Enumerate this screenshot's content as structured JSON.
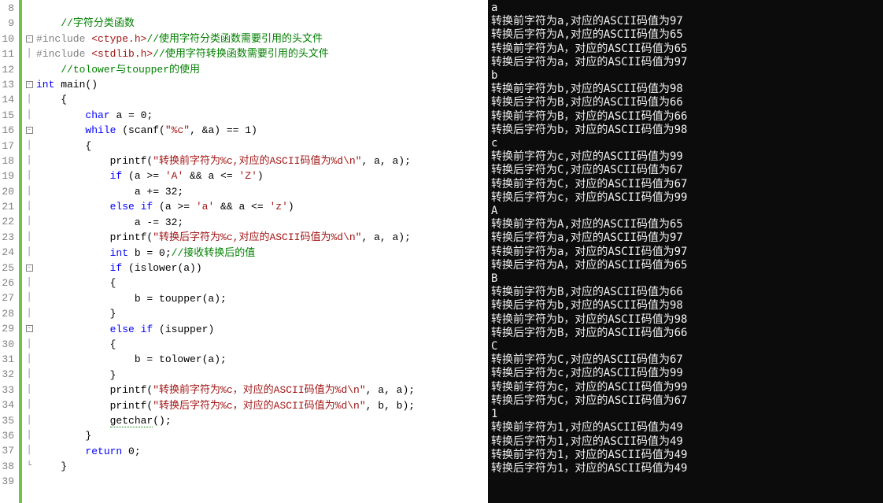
{
  "editor": {
    "first_line": 8,
    "lines": [
      {
        "n": 8,
        "fold": "",
        "tokens": []
      },
      {
        "n": 9,
        "fold": "",
        "tokens": [
          [
            "    ",
            ""
          ],
          [
            "//字符分类函数",
            "cmt"
          ]
        ]
      },
      {
        "n": 10,
        "fold": "box",
        "tokens": [
          [
            "#include ",
            "pp"
          ],
          [
            "<ctype.h>",
            "inc"
          ],
          [
            "//使用字符分类函数需要引用的头文件",
            "cmt"
          ]
        ]
      },
      {
        "n": 11,
        "fold": "bar",
        "tokens": [
          [
            "#include ",
            "pp"
          ],
          [
            "<stdlib.h>",
            "inc"
          ],
          [
            "//使用字符转换函数需要引用的头文件",
            "cmt"
          ]
        ]
      },
      {
        "n": 12,
        "fold": "",
        "tokens": [
          [
            "    ",
            ""
          ],
          [
            "//tolower与toupper的使用",
            "cmt"
          ]
        ]
      },
      {
        "n": 13,
        "fold": "box",
        "tokens": [
          [
            "int",
            "typ"
          ],
          [
            " main()",
            ""
          ]
        ]
      },
      {
        "n": 14,
        "fold": "bar",
        "tokens": [
          [
            "    {",
            ""
          ]
        ]
      },
      {
        "n": 15,
        "fold": "bar",
        "tokens": [
          [
            "        ",
            ""
          ],
          [
            "char",
            "typ"
          ],
          [
            " a = 0;",
            ""
          ]
        ]
      },
      {
        "n": 16,
        "fold": "box",
        "tokens": [
          [
            "        ",
            ""
          ],
          [
            "while",
            "kw"
          ],
          [
            " (scanf(",
            ""
          ],
          [
            "\"%c\"",
            "str"
          ],
          [
            ", &a) == 1)",
            ""
          ]
        ]
      },
      {
        "n": 17,
        "fold": "bar",
        "tokens": [
          [
            "        {",
            ""
          ]
        ]
      },
      {
        "n": 18,
        "fold": "bar",
        "tokens": [
          [
            "            printf(",
            ""
          ],
          [
            "\"转换前字符为%c,对应的ASCII码值为%d",
            "str"
          ],
          [
            "\\n",
            "esc"
          ],
          [
            "\"",
            "str"
          ],
          [
            ", a, a);",
            ""
          ]
        ]
      },
      {
        "n": 19,
        "fold": "bar",
        "tokens": [
          [
            "            ",
            ""
          ],
          [
            "if",
            "kw"
          ],
          [
            " (a >= ",
            ""
          ],
          [
            "'A'",
            "str"
          ],
          [
            " && a <= ",
            ""
          ],
          [
            "'Z'",
            "str"
          ],
          [
            ")",
            ""
          ]
        ]
      },
      {
        "n": 20,
        "fold": "bar",
        "tokens": [
          [
            "                a += 32;",
            ""
          ]
        ]
      },
      {
        "n": 21,
        "fold": "bar",
        "tokens": [
          [
            "            ",
            ""
          ],
          [
            "else if",
            "kw"
          ],
          [
            " (a >= ",
            ""
          ],
          [
            "'a'",
            "str"
          ],
          [
            " && a <= ",
            ""
          ],
          [
            "'z'",
            "str"
          ],
          [
            ")",
            ""
          ]
        ]
      },
      {
        "n": 22,
        "fold": "bar",
        "tokens": [
          [
            "                a -= 32;",
            ""
          ]
        ]
      },
      {
        "n": 23,
        "fold": "bar",
        "tokens": [
          [
            "            printf(",
            ""
          ],
          [
            "\"转换后字符为%c,对应的ASCII码值为%d",
            "str"
          ],
          [
            "\\n",
            "esc"
          ],
          [
            "\"",
            "str"
          ],
          [
            ", a, a);",
            ""
          ]
        ]
      },
      {
        "n": 24,
        "fold": "bar",
        "tokens": [
          [
            "            ",
            ""
          ],
          [
            "int",
            "typ"
          ],
          [
            " b = 0;",
            ""
          ],
          [
            "//接收转换后的值",
            "cmt"
          ]
        ]
      },
      {
        "n": 25,
        "fold": "box",
        "tokens": [
          [
            "            ",
            ""
          ],
          [
            "if",
            "kw"
          ],
          [
            " (islower(a))",
            ""
          ]
        ]
      },
      {
        "n": 26,
        "fold": "bar",
        "tokens": [
          [
            "            {",
            ""
          ]
        ]
      },
      {
        "n": 27,
        "fold": "bar",
        "tokens": [
          [
            "                b = toupper(a);",
            ""
          ]
        ]
      },
      {
        "n": 28,
        "fold": "bar",
        "tokens": [
          [
            "            }",
            ""
          ]
        ]
      },
      {
        "n": 29,
        "fold": "box",
        "tokens": [
          [
            "            ",
            ""
          ],
          [
            "else if",
            "kw"
          ],
          [
            " (isupper)",
            ""
          ]
        ]
      },
      {
        "n": 30,
        "fold": "bar",
        "tokens": [
          [
            "            {",
            ""
          ]
        ]
      },
      {
        "n": 31,
        "fold": "bar",
        "tokens": [
          [
            "                b = tolower(a);",
            ""
          ]
        ]
      },
      {
        "n": 32,
        "fold": "bar",
        "tokens": [
          [
            "            }",
            ""
          ]
        ]
      },
      {
        "n": 33,
        "fold": "bar",
        "tokens": [
          [
            "            printf(",
            ""
          ],
          [
            "\"转换前字符为%c，对应的ASCII码值为%d",
            "str"
          ],
          [
            "\\n",
            "esc"
          ],
          [
            "\"",
            "str"
          ],
          [
            ", a, a);",
            ""
          ]
        ]
      },
      {
        "n": 34,
        "fold": "bar",
        "tokens": [
          [
            "            printf(",
            ""
          ],
          [
            "\"转换后字符为%c，对应的ASCII码值为%d",
            "str"
          ],
          [
            "\\n",
            "esc"
          ],
          [
            "\"",
            "str"
          ],
          [
            ", b, b);",
            ""
          ]
        ]
      },
      {
        "n": 35,
        "fold": "bar",
        "tokens": [
          [
            "            ",
            ""
          ],
          [
            "getchar",
            "underline-err"
          ],
          [
            "();",
            ""
          ]
        ]
      },
      {
        "n": 36,
        "fold": "bar",
        "tokens": [
          [
            "        }",
            ""
          ]
        ]
      },
      {
        "n": 37,
        "fold": "bar",
        "tokens": [
          [
            "        ",
            ""
          ],
          [
            "return",
            "kw"
          ],
          [
            " 0;",
            ""
          ]
        ]
      },
      {
        "n": 38,
        "fold": "end",
        "tokens": [
          [
            "    }",
            ""
          ]
        ]
      },
      {
        "n": 39,
        "fold": "",
        "tokens": []
      }
    ]
  },
  "console": {
    "lines": [
      "a",
      "转换前字符为a,对应的ASCII码值为97",
      "转换后字符为A,对应的ASCII码值为65",
      "转换前字符为A，对应的ASCII码值为65",
      "转换后字符为a，对应的ASCII码值为97",
      "b",
      "转换前字符为b,对应的ASCII码值为98",
      "转换后字符为B,对应的ASCII码值为66",
      "转换前字符为B，对应的ASCII码值为66",
      "转换后字符为b，对应的ASCII码值为98",
      "c",
      "转换前字符为c,对应的ASCII码值为99",
      "转换后字符为C,对应的ASCII码值为67",
      "转换前字符为C，对应的ASCII码值为67",
      "转换后字符为c，对应的ASCII码值为99",
      "A",
      "转换前字符为A,对应的ASCII码值为65",
      "转换后字符为a,对应的ASCII码值为97",
      "转换前字符为a，对应的ASCII码值为97",
      "转换后字符为A，对应的ASCII码值为65",
      "B",
      "转换前字符为B,对应的ASCII码值为66",
      "转换后字符为b,对应的ASCII码值为98",
      "转换前字符为b，对应的ASCII码值为98",
      "转换后字符为B，对应的ASCII码值为66",
      "C",
      "转换前字符为C,对应的ASCII码值为67",
      "转换后字符为c,对应的ASCII码值为99",
      "转换前字符为c，对应的ASCII码值为99",
      "转换后字符为C，对应的ASCII码值为67",
      "1",
      "转换前字符为1,对应的ASCII码值为49",
      "转换后字符为1,对应的ASCII码值为49",
      "转换前字符为1，对应的ASCII码值为49",
      "转换后字符为1，对应的ASCII码值为49"
    ]
  }
}
